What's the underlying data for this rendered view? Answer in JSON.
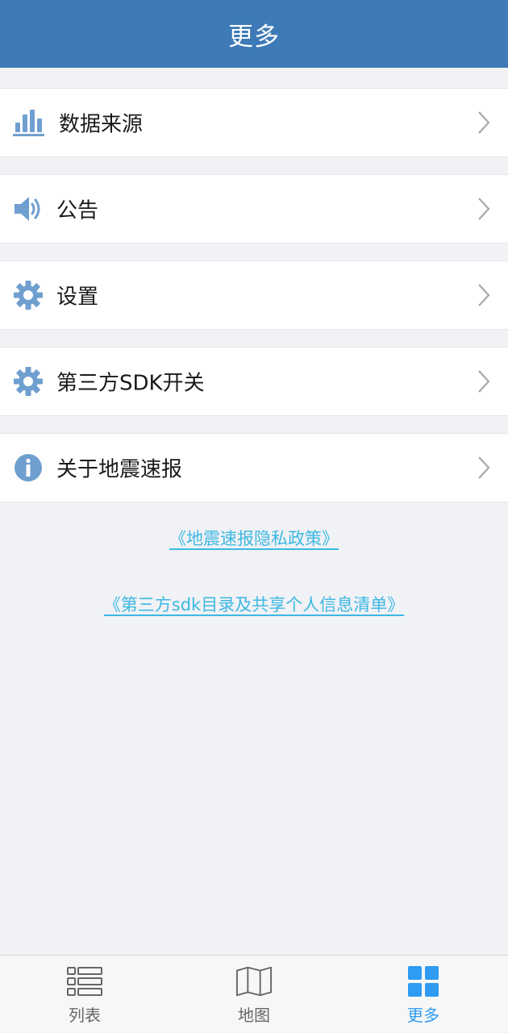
{
  "header": {
    "title": "更多"
  },
  "menu": {
    "items": [
      {
        "label": "数据来源"
      },
      {
        "label": "公告"
      },
      {
        "label": "设置"
      },
      {
        "label": "第三方SDK开关"
      },
      {
        "label": "关于地震速报"
      }
    ]
  },
  "links": {
    "privacy_policy": "《地震速报隐私政策》",
    "sdk_list": "《第三方sdk目录及共享个人信息清单》"
  },
  "tabbar": {
    "tabs": [
      {
        "label": "列表",
        "active": false
      },
      {
        "label": "地图",
        "active": false
      },
      {
        "label": "更多",
        "active": true
      }
    ]
  },
  "colors": {
    "header_bg": "#3d7ab7",
    "icon_blue": "#6f9fcf",
    "link": "#3db8e4",
    "tab_active": "#2f9bf2",
    "tab_inactive": "#666666"
  }
}
